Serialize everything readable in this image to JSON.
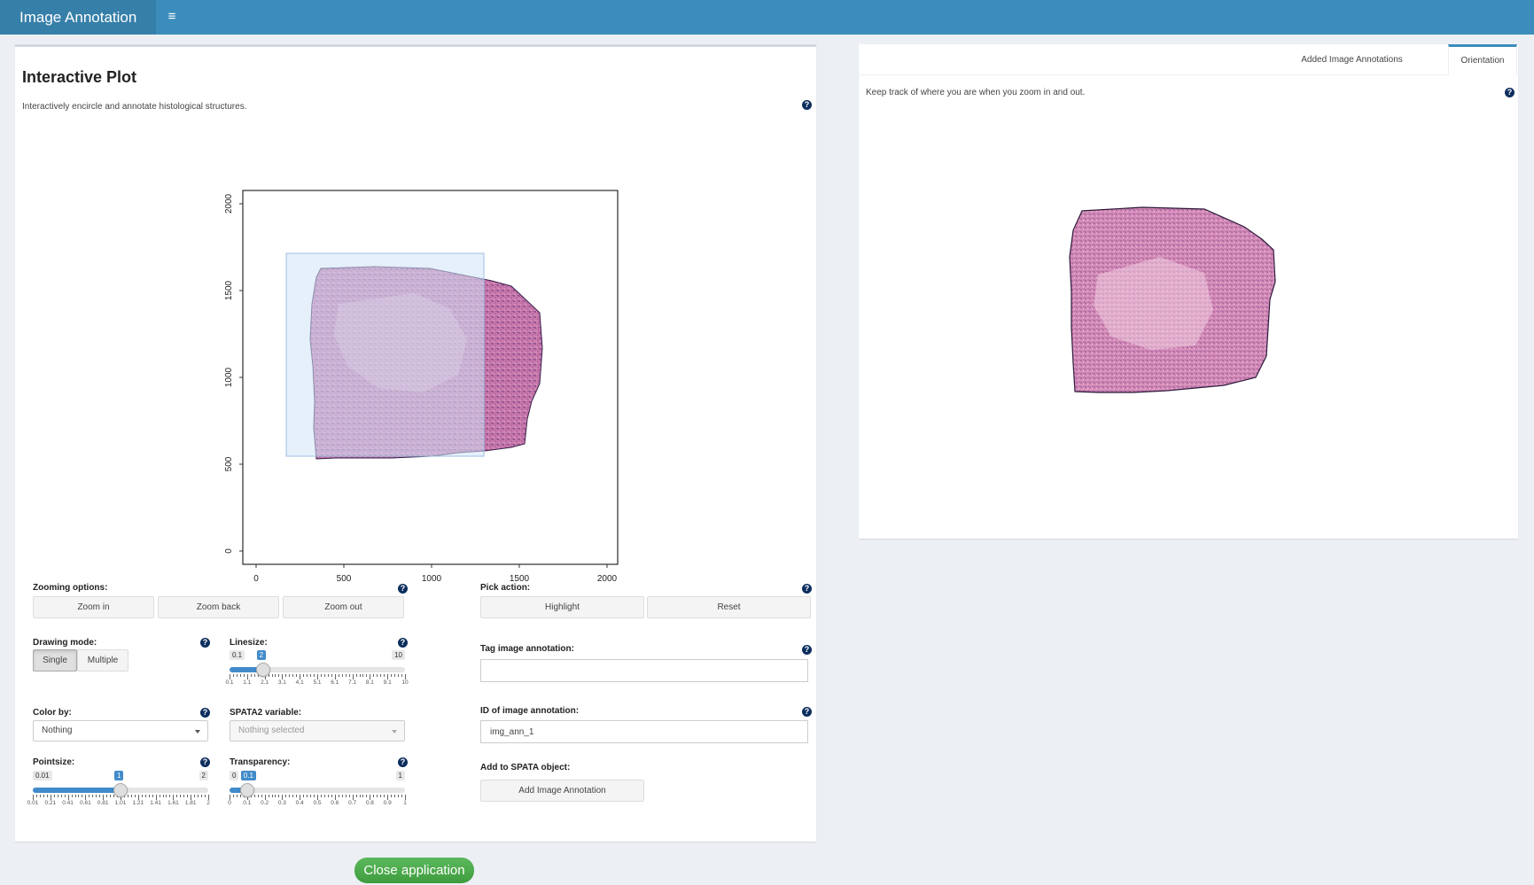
{
  "app": {
    "title": "Image Annotation",
    "menu_icon": "≡",
    "close_label": "Close application"
  },
  "left_panel": {
    "title": "Interactive Plot",
    "subtitle": "Interactively encircle and annotate histological structures.",
    "plot": {
      "x_ticks": [
        "0",
        "500",
        "1000",
        "1500",
        "2000"
      ],
      "y_ticks": [
        "0",
        "500",
        "1000",
        "1500",
        "2000"
      ],
      "zoom_rect": {
        "x": [
          180,
          1300
        ],
        "y": [
          545,
          1720
        ]
      }
    },
    "zooming": {
      "label": "Zooming options:",
      "buttons": [
        "Zoom in",
        "Zoom back",
        "Zoom out"
      ]
    },
    "drawing_mode": {
      "label": "Drawing mode:",
      "options": [
        "Single",
        "Multiple"
      ],
      "selected": "Single"
    },
    "linesize": {
      "label": "Linesize:",
      "min": "0.1",
      "max": "10",
      "value": "2",
      "value_fraction": 0.19,
      "tick_labels": [
        "0.1",
        "1.1",
        "2.1",
        "3.1",
        "4.1",
        "5.1",
        "6.1",
        "7.1",
        "8.1",
        "9.1",
        "10"
      ]
    },
    "color_by": {
      "label": "Color by:",
      "value": "Nothing"
    },
    "spata2_variable": {
      "label": "SPATA2 variable:",
      "value": "Nothing selected"
    },
    "pointsize": {
      "label": "Pointsize:",
      "min": "0.01",
      "max": "2",
      "value": "1",
      "value_fraction": 0.5,
      "tick_labels": [
        "0.01",
        "0.21",
        "0.41",
        "0.61",
        "0.81",
        "1.01",
        "1.21",
        "1.41",
        "1.61",
        "1.81",
        "2"
      ]
    },
    "transparency": {
      "label": "Transparency:",
      "min": "0",
      "max": "1",
      "value": "0.1",
      "value_fraction": 0.1,
      "tick_labels": [
        "0",
        "0.1",
        "0.2",
        "0.3",
        "0.4",
        "0.5",
        "0.6",
        "0.7",
        "0.8",
        "0.9",
        "1"
      ]
    },
    "pick_action": {
      "label": "Pick action:",
      "buttons": [
        "Highlight",
        "Reset"
      ]
    },
    "tag": {
      "label": "Tag image annotation:",
      "value": ""
    },
    "id": {
      "label": "ID of image annotation:",
      "value": "img_ann_1"
    },
    "add": {
      "label": "Add to SPATA object:",
      "button": "Add Image Annotation"
    }
  },
  "right_panel": {
    "tabs": [
      "Added Image Annotations",
      "Orientation"
    ],
    "active_tab": "Orientation",
    "subtitle": "Keep track of where you are when you zoom in and out."
  },
  "colors": {
    "header": "#3c8dbc",
    "brand": "#367fa9",
    "accent": "#428bca",
    "tissue_pink": "#c46fa8",
    "tissue_purple": "#7a3f85",
    "zoom_overlay": "#cfe3f7",
    "close_green": "#4caf50"
  }
}
